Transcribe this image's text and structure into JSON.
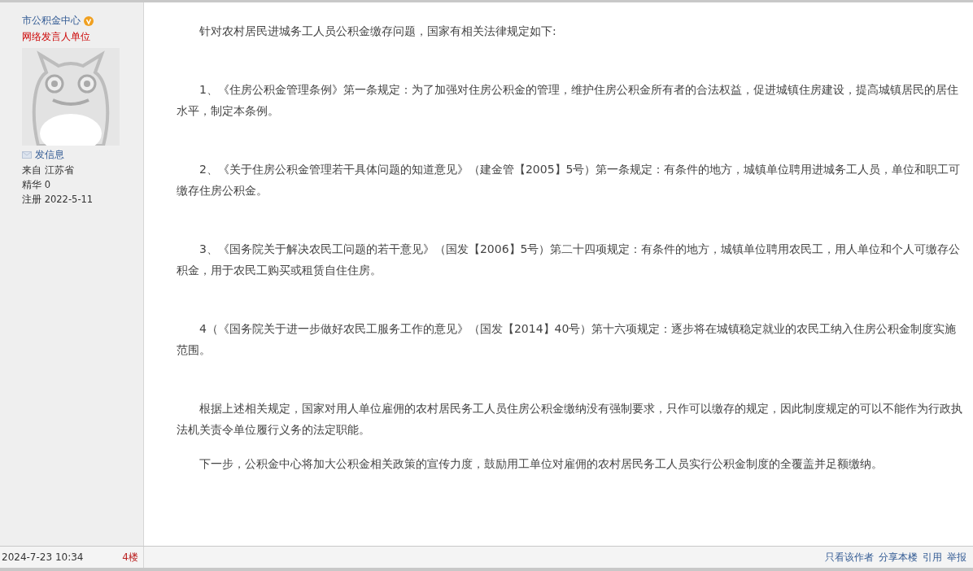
{
  "author": {
    "name": "市公积金中心",
    "verified": true,
    "role": "网络发言人单位",
    "message_link": "发信息",
    "from": "来自 江苏省",
    "digest": "精华 0",
    "registered": "注册 2022-5-11"
  },
  "post": {
    "paragraphs": [
      "针对农村居民进城务工人员公积金缴存问题，国家有相关法律规定如下:",
      "1、《住房公积金管理条例》第一条规定：为了加强对住房公积金的管理，维护住房公积金所有者的合法权益，促进城镇住房建设，提高城镇居民的居住水平，制定本条例。",
      "2、《关于住房公积金管理若干具体问题的知道意见》（建金管【2005】5号）第一条规定：有条件的地方，城镇单位聘用进城务工人员，单位和职工可缴存住房公积金。",
      "3、《国务院关于解决农民工问题的若干意见》（国发【2006】5号）第二十四项规定：有条件的地方，城镇单位聘用农民工，用人单位和个人可缴存公积金，用于农民工购买或租赁自住住房。",
      "4（《国务院关于进一步做好农民工服务工作的意见》（国发【2014】40号）第十六项规定：逐步将在城镇稳定就业的农民工纳入住房公积金制度实施范围。",
      "根据上述相关规定，国家对用人单位雇佣的农村居民务工人员住房公积金缴纳没有强制要求，只作可以缴存的规定，因此制度规定的可以不能作为行政执法机关责令单位履行义务的法定职能。",
      "下一步，公积金中心将加大公积金相关政策的宣传力度，鼓励用工单位对雇佣的农村居民务工人员实行公积金制度的全覆盖并足额缴纳。"
    ]
  },
  "footer": {
    "time": "2024-7-23 10:34",
    "floor": "4楼",
    "actions": [
      "只看该作者",
      "分享本楼",
      "引用",
      "举报"
    ]
  }
}
